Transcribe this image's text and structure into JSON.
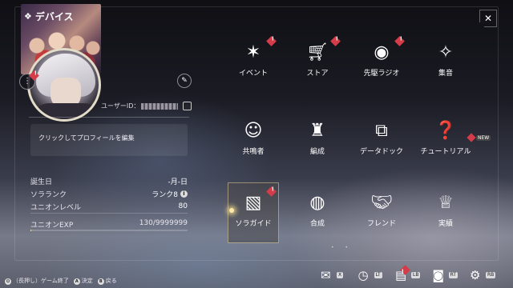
{
  "header": {
    "title": "デバイス",
    "close_icon": "close-icon"
  },
  "profile": {
    "user_id_label": "ユーザーID：",
    "edit_prompt": "クリックしてプロフィールを編集",
    "stats": [
      {
        "label": "誕生日",
        "value": "-月-日"
      },
      {
        "label": "ソラランク",
        "value": "ランク8"
      },
      {
        "label": "ユニオンレベル",
        "value": "80"
      }
    ],
    "exp_label": "ユニオンEXP",
    "exp_value": "130/9999999",
    "exp_fraction": 1.3e-05
  },
  "menu": [
    {
      "label": "イベント",
      "icon": "event-icon",
      "badge": true
    },
    {
      "label": "ストア",
      "icon": "store-cart-icon",
      "badge": true
    },
    {
      "label": "先駆ラジオ",
      "icon": "radio-icon",
      "badge": true
    },
    {
      "label": "集音",
      "icon": "gacha-compass-icon",
      "badge": false
    },
    {
      "label": "共鳴者",
      "icon": "resonator-icon",
      "badge": false
    },
    {
      "label": "編成",
      "icon": "chess-formation-icon",
      "badge": false
    },
    {
      "label": "データドック",
      "icon": "data-dock-icon",
      "badge": false
    },
    {
      "label": "チュートリアル",
      "icon": "tutorial-book-icon",
      "badge": false
    },
    {
      "label": "ソラガイド",
      "icon": "guide-book-icon",
      "badge": true
    },
    {
      "label": "合成",
      "icon": "synthesis-icon",
      "badge": false
    },
    {
      "label": "フレンド",
      "icon": "handshake-icon",
      "badge": false
    },
    {
      "label": "実績",
      "icon": "trophy-icon",
      "badge": false
    }
  ],
  "tutorial_tag": "NEW",
  "bottom_hints": {
    "long_press": "（長押し）ゲーム終了",
    "confirm_key": "A",
    "confirm": "決定",
    "back_key": "B",
    "back": "戻る"
  },
  "bottom_icons": [
    {
      "name": "mail-icon",
      "key": "X"
    },
    {
      "name": "clock-icon",
      "key": "LT"
    },
    {
      "name": "notice-icon",
      "key": "LB"
    },
    {
      "name": "camera-icon",
      "key": "RT"
    },
    {
      "name": "settings-gear-icon",
      "key": "RB"
    }
  ],
  "colors": {
    "badge_red": "#d43c4a",
    "exp_fill": "#e6d9b3"
  }
}
